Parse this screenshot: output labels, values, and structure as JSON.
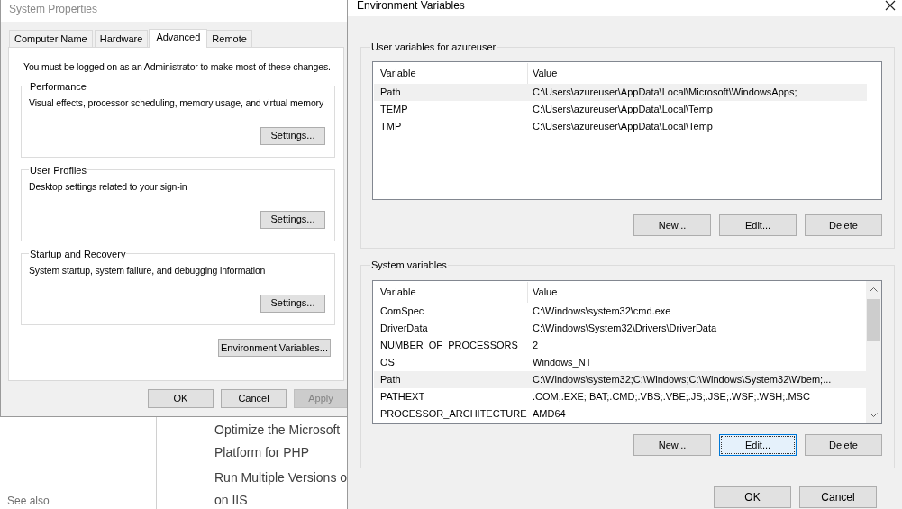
{
  "system_properties": {
    "title": "System Properties",
    "tabs": [
      {
        "label": "Computer Name",
        "selected": false
      },
      {
        "label": "Hardware",
        "selected": false
      },
      {
        "label": "Advanced",
        "selected": true
      },
      {
        "label": "Remote",
        "selected": false
      }
    ],
    "notice": "You must be logged on as an Administrator to make most of these changes.",
    "groups": [
      {
        "label": "Performance",
        "description": "Visual effects, processor scheduling, memory usage, and virtual memory",
        "button": "Settings..."
      },
      {
        "label": "User Profiles",
        "description": "Desktop settings related to your sign-in",
        "button": "Settings..."
      },
      {
        "label": "Startup and Recovery",
        "description": "System startup, system failure, and debugging information",
        "button": "Settings..."
      }
    ],
    "env_button": "Environment Variables...",
    "buttons": [
      {
        "label": "OK",
        "disabled": false
      },
      {
        "label": "Cancel",
        "disabled": false
      },
      {
        "label": "Apply",
        "disabled": true
      }
    ]
  },
  "background_page": {
    "see_also": "See also",
    "links": [
      {
        "lines": [
          "Optimize the Microsoft",
          "Platform for PHP"
        ]
      },
      {
        "lines": [
          "Run Multiple Versions o",
          "on IIS"
        ]
      }
    ]
  },
  "environment_variables": {
    "title": "Environment Variables",
    "user_section": {
      "label": "User variables for azureuser",
      "columns": [
        "Variable",
        "Value"
      ],
      "rows": [
        {
          "variable": "Path",
          "value": "C:\\Users\\azureuser\\AppData\\Local\\Microsoft\\WindowsApps;",
          "selected": true
        },
        {
          "variable": "TEMP",
          "value": "C:\\Users\\azureuser\\AppData\\Local\\Temp",
          "selected": false
        },
        {
          "variable": "TMP",
          "value": "C:\\Users\\azureuser\\AppData\\Local\\Temp",
          "selected": false
        }
      ],
      "buttons": [
        {
          "label": "New...",
          "focused": false
        },
        {
          "label": "Edit...",
          "focused": false
        },
        {
          "label": "Delete",
          "focused": false
        }
      ]
    },
    "system_section": {
      "label": "System variables",
      "columns": [
        "Variable",
        "Value"
      ],
      "rows": [
        {
          "variable": "ComSpec",
          "value": "C:\\Windows\\system32\\cmd.exe",
          "selected": false
        },
        {
          "variable": "DriverData",
          "value": "C:\\Windows\\System32\\Drivers\\DriverData",
          "selected": false
        },
        {
          "variable": "NUMBER_OF_PROCESSORS",
          "value": "2",
          "selected": false
        },
        {
          "variable": "OS",
          "value": "Windows_NT",
          "selected": false
        },
        {
          "variable": "Path",
          "value": "C:\\Windows\\system32;C:\\Windows;C:\\Windows\\System32\\Wbem;...",
          "selected": true
        },
        {
          "variable": "PATHEXT",
          "value": ".COM;.EXE;.BAT;.CMD;.VBS;.VBE;.JS;.JSE;.WSF;.WSH;.MSC",
          "selected": false
        },
        {
          "variable": "PROCESSOR_ARCHITECTURE",
          "value": "AMD64",
          "selected": false
        }
      ],
      "buttons": [
        {
          "label": "New...",
          "focused": false
        },
        {
          "label": "Edit...",
          "focused": true
        },
        {
          "label": "Delete",
          "focused": false
        }
      ]
    },
    "buttons": [
      {
        "label": "OK",
        "focused": false
      },
      {
        "label": "Cancel",
        "focused": false
      }
    ]
  }
}
